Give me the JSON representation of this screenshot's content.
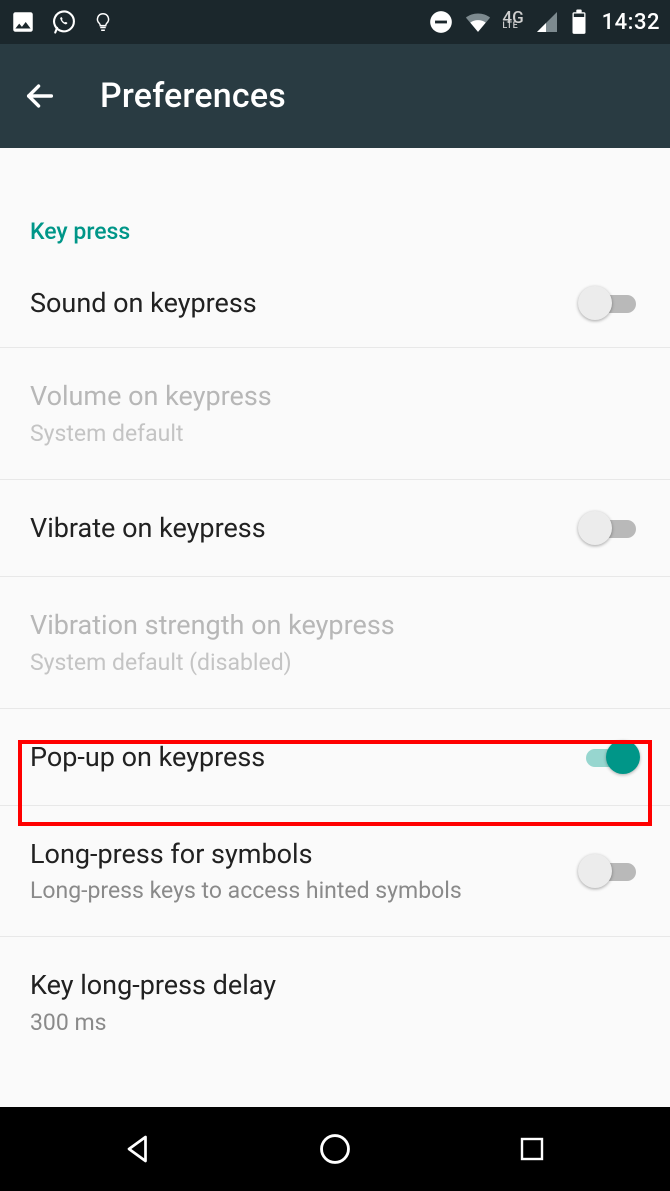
{
  "status": {
    "clock": "14:32"
  },
  "appbar": {
    "title": "Preferences"
  },
  "section": {
    "header": "Key press"
  },
  "items": {
    "sound": {
      "label": "Sound on keypress",
      "on": false
    },
    "volume": {
      "label": "Volume on keypress",
      "sub": "System default",
      "disabled": true
    },
    "vibrate": {
      "label": "Vibrate on keypress",
      "on": false
    },
    "vibstr": {
      "label": "Vibration strength on keypress",
      "sub": "System default (disabled)",
      "disabled": true
    },
    "popup": {
      "label": "Pop-up on keypress",
      "on": true
    },
    "longsym": {
      "label": "Long-press for symbols",
      "sub": "Long-press keys to access hinted symbols",
      "on": false
    },
    "longdel": {
      "label": "Key long-press delay",
      "sub": "300 ms"
    }
  }
}
